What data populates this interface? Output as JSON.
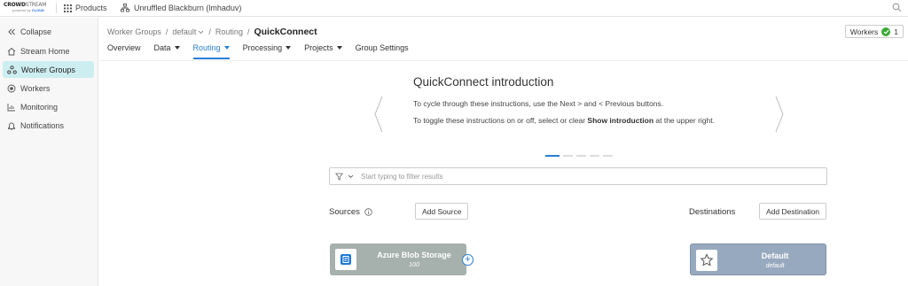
{
  "topbar": {
    "logo_line1_bold": "CROWD",
    "logo_line1_rest": "STREAM",
    "logo_line2_prefix": "powered by ",
    "logo_line2_brand": "CLOUD",
    "products_label": "Products",
    "org_label": "Unruffled Blackburn (lmhaduv)"
  },
  "sidebar": {
    "items": [
      {
        "label": "Collapse",
        "icon": "collapse-icon"
      },
      {
        "label": "Stream Home",
        "icon": "home-icon"
      },
      {
        "label": "Worker Groups",
        "icon": "worker-groups-icon",
        "active": true
      },
      {
        "label": "Workers",
        "icon": "workers-icon"
      },
      {
        "label": "Monitoring",
        "icon": "monitoring-icon"
      },
      {
        "label": "Notifications",
        "icon": "bell-icon"
      }
    ]
  },
  "breadcrumb": {
    "part1": "Worker Groups",
    "sep1": "/",
    "part2": "default",
    "sep2": "/",
    "part3": "Routing",
    "sep3": "/",
    "current": "QuickConnect"
  },
  "workers_badge": {
    "label": "Workers",
    "count": "1",
    "status_color": "#3aaa35"
  },
  "tabs": [
    {
      "label": "Overview",
      "dropdown": false
    },
    {
      "label": "Data",
      "dropdown": true
    },
    {
      "label": "Routing",
      "dropdown": true,
      "active": true
    },
    {
      "label": "Processing",
      "dropdown": true
    },
    {
      "label": "Projects",
      "dropdown": true
    },
    {
      "label": "Group Settings",
      "dropdown": false
    }
  ],
  "intro": {
    "title": "QuickConnect introduction",
    "line1": "To cycle through these instructions, use the Next > and < Previous buttons.",
    "line2_before": "To toggle these instructions on or off, select or clear ",
    "line2_bold": "Show introduction",
    "line2_after": " at the upper right.",
    "page_count": 5,
    "current_page": 1
  },
  "filter": {
    "placeholder": "Start typing to filter results"
  },
  "sources": {
    "label": "Sources",
    "add_button": "Add Source",
    "cards": [
      {
        "name": "Azure Blob Storage",
        "sub": "100",
        "color": "#a6b0ad"
      }
    ]
  },
  "destinations": {
    "label": "Destinations",
    "add_button": "Add Destination",
    "cards": [
      {
        "name": "Default",
        "sub": "default",
        "color": "#97a9be"
      }
    ]
  },
  "colors": {
    "accent": "#2a7fd4",
    "active_nav": "#cdeef1"
  }
}
